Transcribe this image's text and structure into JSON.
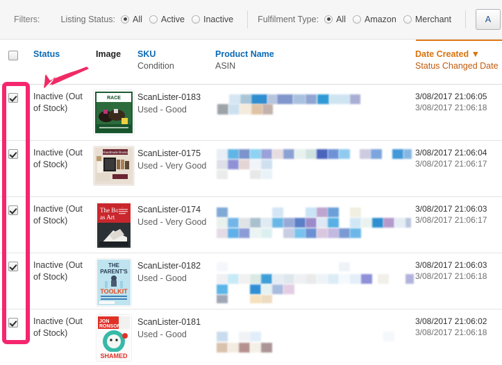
{
  "filters": {
    "label": "Filters:",
    "groups": [
      {
        "name": "listing-status",
        "label": "Listing Status:",
        "options": [
          {
            "label": "All",
            "checked": true
          },
          {
            "label": "Active",
            "checked": false
          },
          {
            "label": "Inactive",
            "checked": false
          }
        ]
      },
      {
        "name": "fulfilment-type",
        "label": "Fulfilment Type:",
        "options": [
          {
            "label": "All",
            "checked": true
          },
          {
            "label": "Amazon",
            "checked": false
          },
          {
            "label": "Merchant",
            "checked": false
          }
        ]
      }
    ],
    "edge_button_label": "A"
  },
  "table": {
    "select_all_checked": false,
    "headers": {
      "status": "Status",
      "image": "Image",
      "sku": "SKU",
      "condition": "Condition",
      "product_name": "Product Name",
      "asin": "ASIN",
      "date_created": "Date Created",
      "date_created_sort_glyph": "▼",
      "status_changed_date": "Status Changed Date"
    },
    "rows": [
      {
        "checked": true,
        "status": "Inactive (Out of Stock)",
        "sku": "ScanLister-0183",
        "condition": "Used - Good",
        "image_alt": "race-night-dvd-cover",
        "date_created": "3/08/2017 21:06:05",
        "status_changed": "3/08/2017 21:06:18"
      },
      {
        "checked": true,
        "status": "Inactive (Out of Stock)",
        "sku": "ScanLister-0175",
        "condition": "Used - Very Good",
        "image_alt": "handmade-books-cover",
        "date_created": "3/08/2017 21:06:04",
        "status_changed": "3/08/2017 21:06:17"
      },
      {
        "checked": true,
        "status": "Inactive (Out of Stock)",
        "sku": "ScanLister-0174",
        "condition": "Used - Very Good",
        "image_alt": "the-book-as-art-cover",
        "date_created": "3/08/2017 21:06:03",
        "status_changed": "3/08/2017 21:06:17"
      },
      {
        "checked": true,
        "status": "Inactive (Out of Stock)",
        "sku": "ScanLister-0182",
        "condition": "Used - Good",
        "image_alt": "the-parents-toolkit-cover",
        "date_created": "3/08/2017 21:06:03",
        "status_changed": "3/08/2017 21:06:18"
      },
      {
        "checked": true,
        "status": "Inactive (Out of Stock)",
        "sku": "ScanLister-0181",
        "condition": "Used - Good",
        "image_alt": "jon-ronson-so-youve-been-publicly-shamed-cover",
        "date_created": "3/08/2017 21:06:02",
        "status_changed": "3/08/2017 21:06:18"
      }
    ]
  },
  "annotations": {
    "highlight_color": "#f5256e",
    "highlight_target": "checkbox-column",
    "arrow_color": "#ef2a64",
    "arrow_points_to": "select-all-checkbox"
  },
  "colors": {
    "link_blue": "#0b6ab5",
    "sort_orange": "#d9730d",
    "filter_bar_bg": "#f6f6f6",
    "row_border": "#e4e4e4"
  }
}
